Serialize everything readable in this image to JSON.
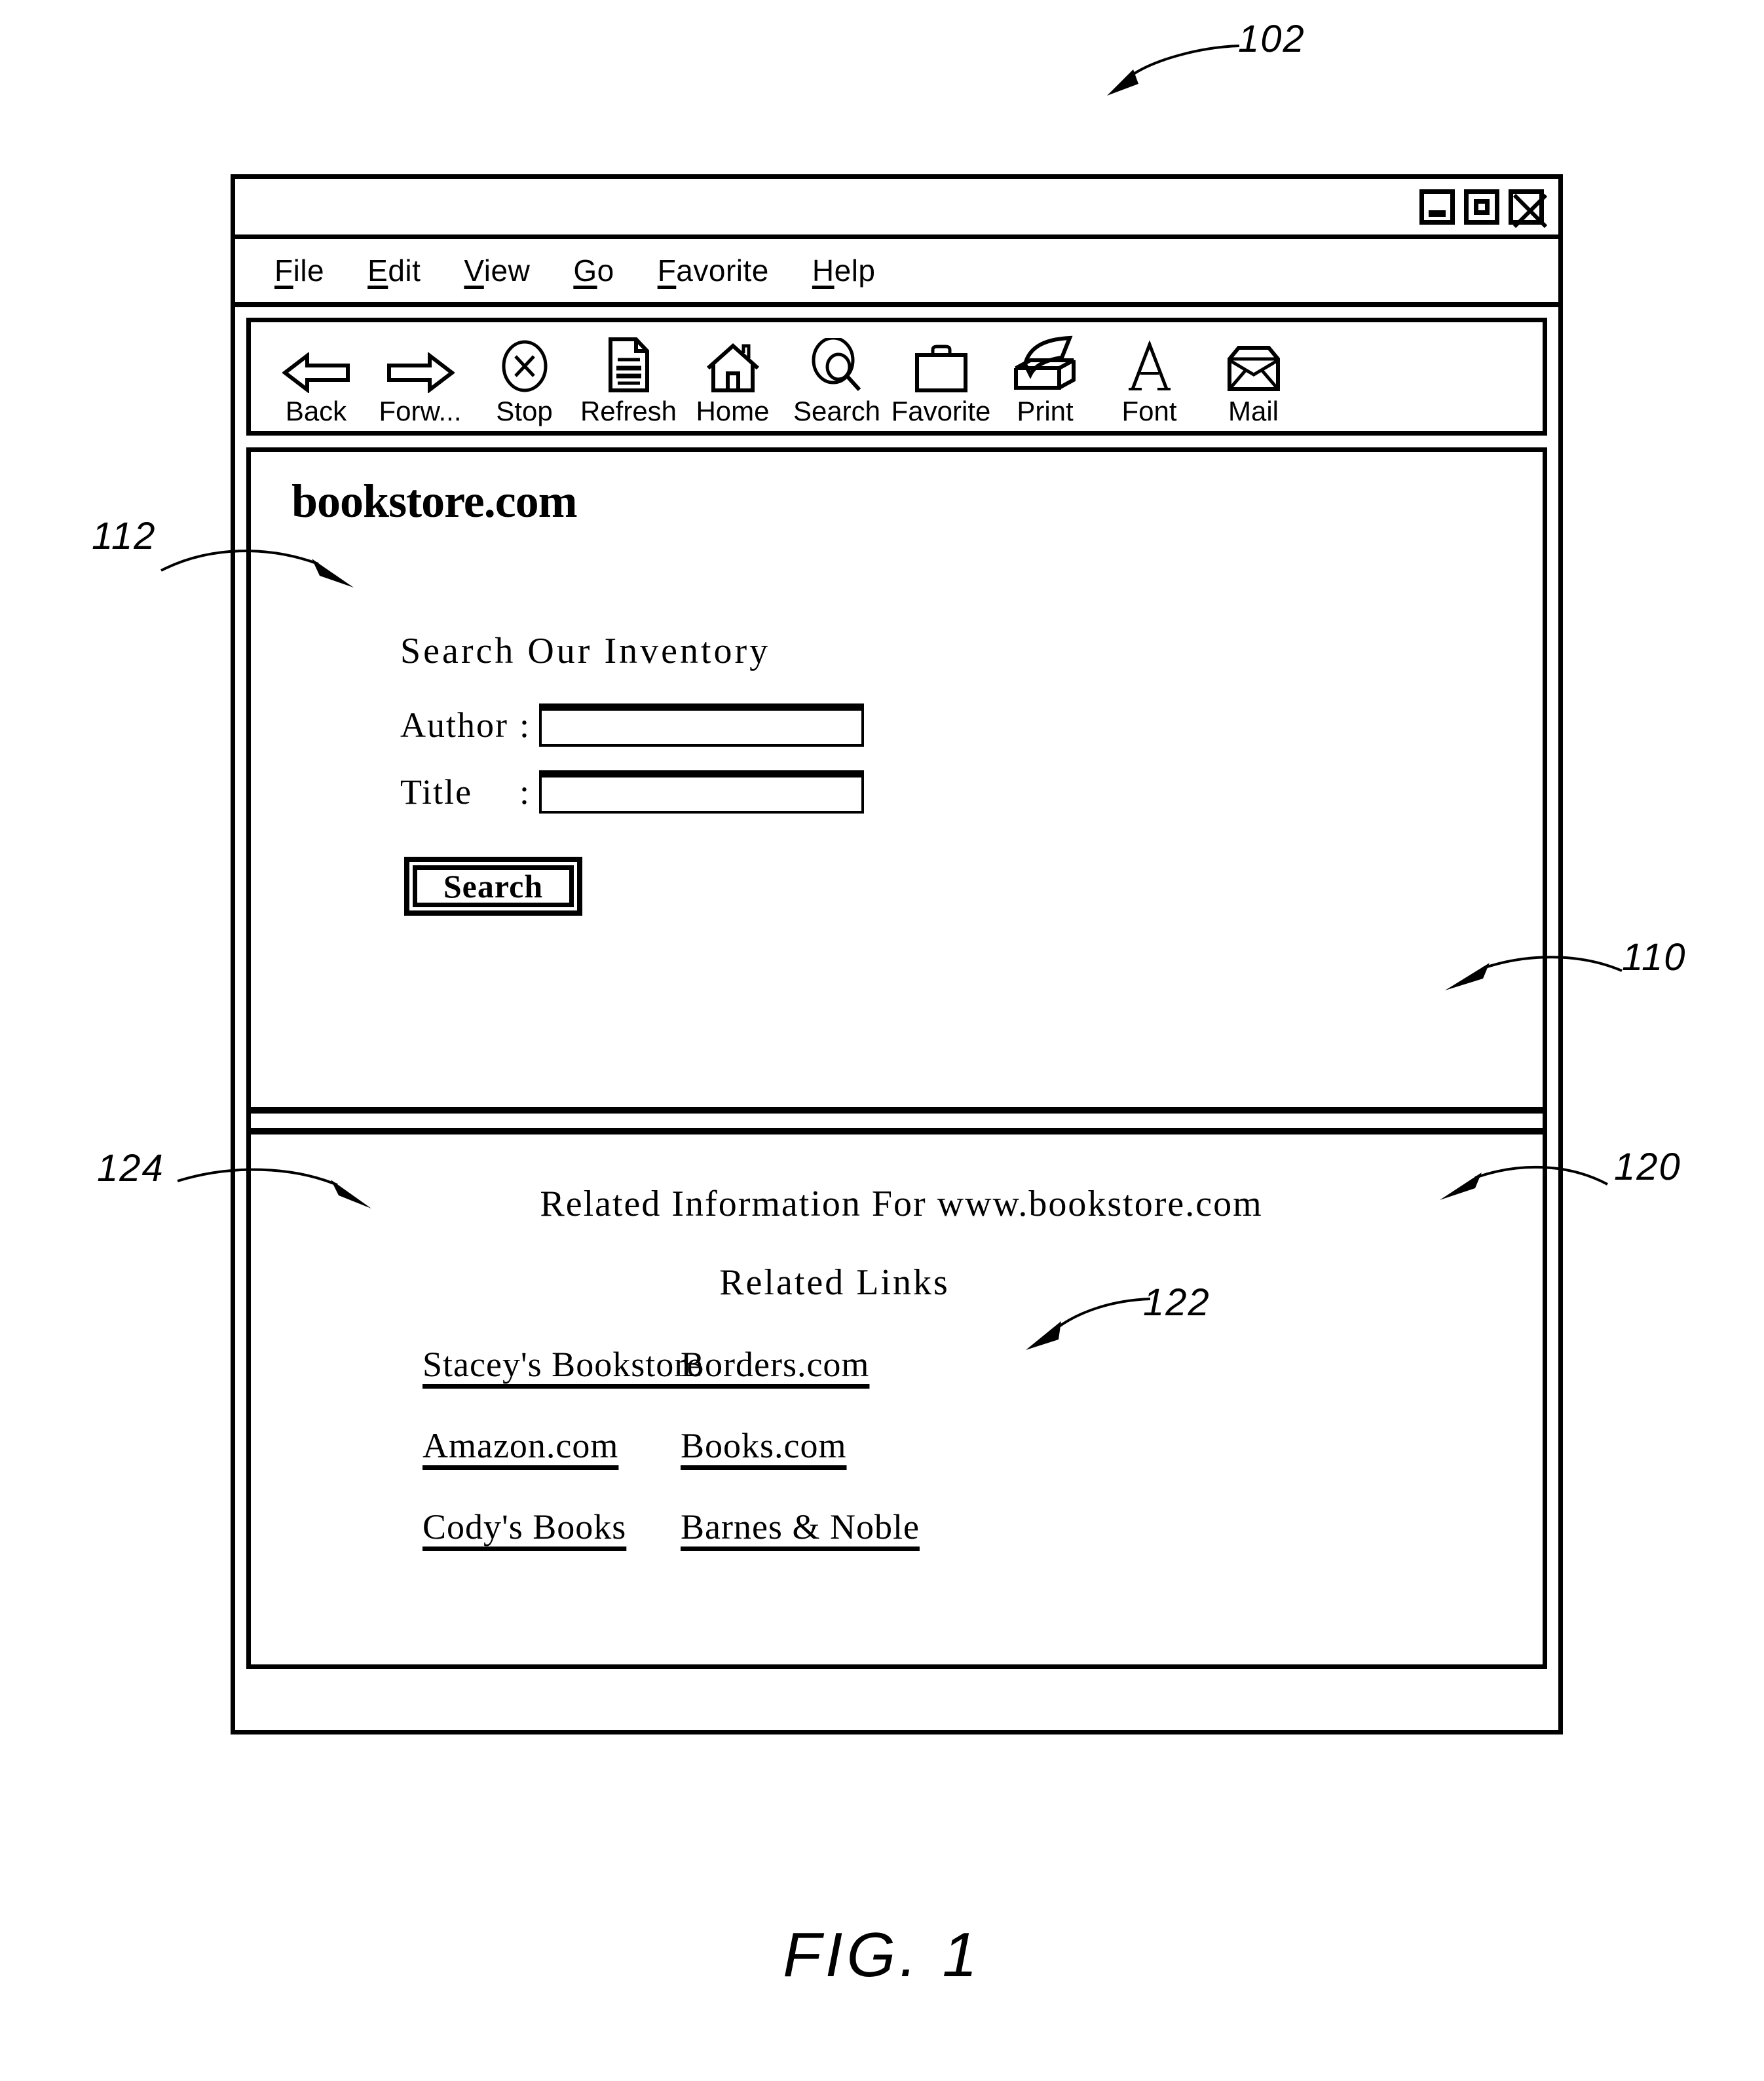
{
  "figure": {
    "caption": "FIG.  1",
    "reference_numerals": [
      {
        "id": "102",
        "label": "102",
        "target": "browser-window"
      },
      {
        "id": "112",
        "label": "112",
        "target": "site-logo"
      },
      {
        "id": "110",
        "label": "110",
        "target": "search-pane"
      },
      {
        "id": "124",
        "label": "124",
        "target": "related-information-heading"
      },
      {
        "id": "120",
        "label": "120",
        "target": "related-pane"
      },
      {
        "id": "122",
        "label": "122",
        "target": "related-link-borders"
      }
    ]
  },
  "browser": {
    "title_bar": {
      "window_controls": [
        {
          "name": "minimize-button",
          "icon": "minimize-icon"
        },
        {
          "name": "maximize-button",
          "icon": "maximize-icon"
        },
        {
          "name": "close-button",
          "icon": "close-icon"
        }
      ]
    },
    "menu_bar": {
      "items": [
        {
          "label": "File",
          "accel": "F"
        },
        {
          "label": "Edit",
          "accel": "E"
        },
        {
          "label": "View",
          "accel": "V"
        },
        {
          "label": "Go",
          "accel": "G"
        },
        {
          "label": "Favorite",
          "accel": "F"
        },
        {
          "label": "Help",
          "accel": "H"
        }
      ]
    },
    "toolbar": {
      "buttons": [
        {
          "label": "Back",
          "icon": "arrow-left-icon"
        },
        {
          "label": "Forw...",
          "icon": "arrow-right-icon"
        },
        {
          "label": "Stop",
          "icon": "stop-x-circle-icon"
        },
        {
          "label": "Refresh",
          "icon": "document-page-icon"
        },
        {
          "label": "Home",
          "icon": "house-icon"
        },
        {
          "label": "Search",
          "icon": "magnifier-icon"
        },
        {
          "label": "Favorite",
          "icon": "briefcase-icon"
        },
        {
          "label": "Print",
          "icon": "printer-icon"
        },
        {
          "label": "Font",
          "icon": "letter-a-icon"
        },
        {
          "label": "Mail",
          "icon": "envelope-icon"
        }
      ]
    }
  },
  "page": {
    "site_logo": "bookstore.com",
    "search_form": {
      "heading": "Search Our Inventory",
      "fields": [
        {
          "label": "Author",
          "colon": ":",
          "value": "",
          "placeholder": ""
        },
        {
          "label": "Title",
          "colon": ":",
          "value": "",
          "placeholder": ""
        }
      ],
      "submit_label": "Search"
    }
  },
  "related": {
    "heading": "Related Information For www.bookstore.com",
    "links_heading": "Related Links",
    "links": [
      "Stacey's Bookstore",
      "Borders.com",
      "Amazon.com",
      "Books.com",
      "Cody's Books",
      "Barnes & Noble"
    ]
  }
}
